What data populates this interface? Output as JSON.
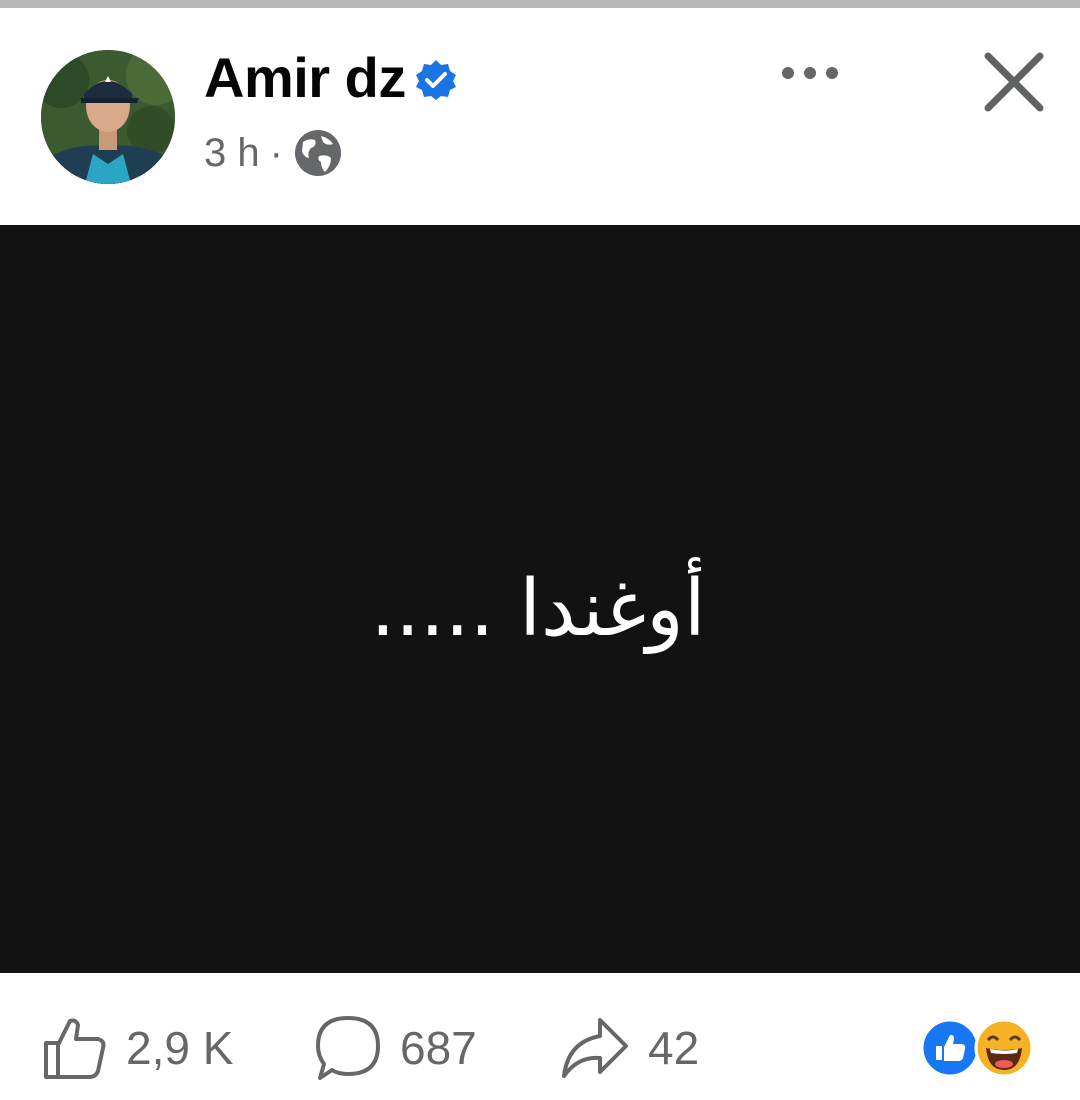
{
  "post": {
    "author_name": "Amir dz",
    "time": "3 h",
    "separator": "·",
    "text": "أوغندا .....",
    "privacy_icon": "globe-icon"
  },
  "actions": {
    "likes": "2,9 K",
    "comments": "687",
    "shares": "42"
  },
  "reactions": [
    "like-icon",
    "haha-icon"
  ],
  "colors": {
    "verified": "#1b74e4",
    "like_reaction": "#1877f2",
    "haha_reaction": "#f7b125",
    "post_background": "#121212",
    "secondary_text": "#65676b"
  }
}
